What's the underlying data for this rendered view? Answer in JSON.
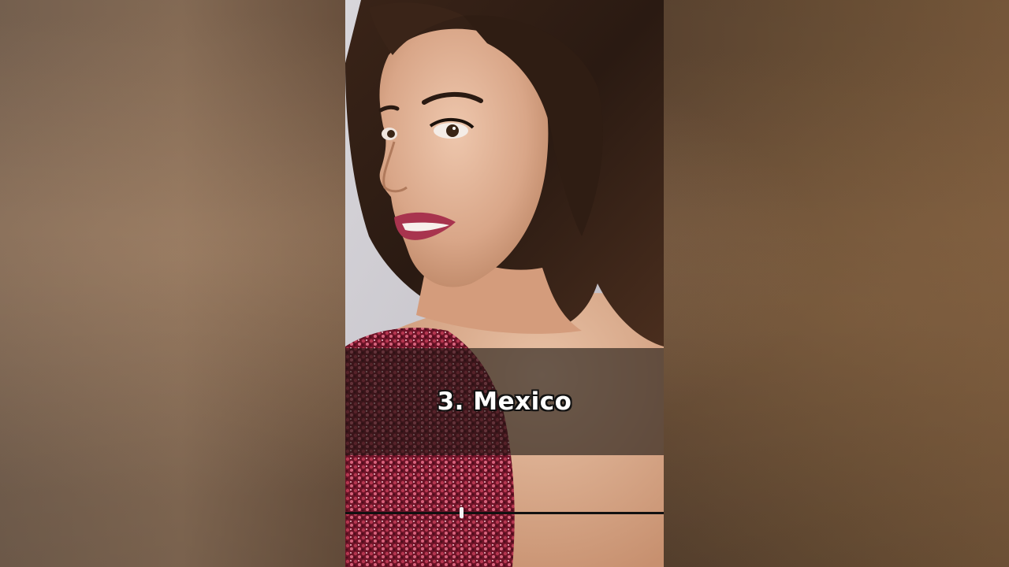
{
  "video": {
    "caption": "3. Mexico",
    "progress": 0.364
  },
  "colors": {
    "background_blur": "#6e5540",
    "caption_band": "#1c1612",
    "caption_text": "#ffffff",
    "progress_track": "#111111",
    "progress_thumb": "#f4f4f4",
    "dress_sequins": "#8e1f35"
  }
}
